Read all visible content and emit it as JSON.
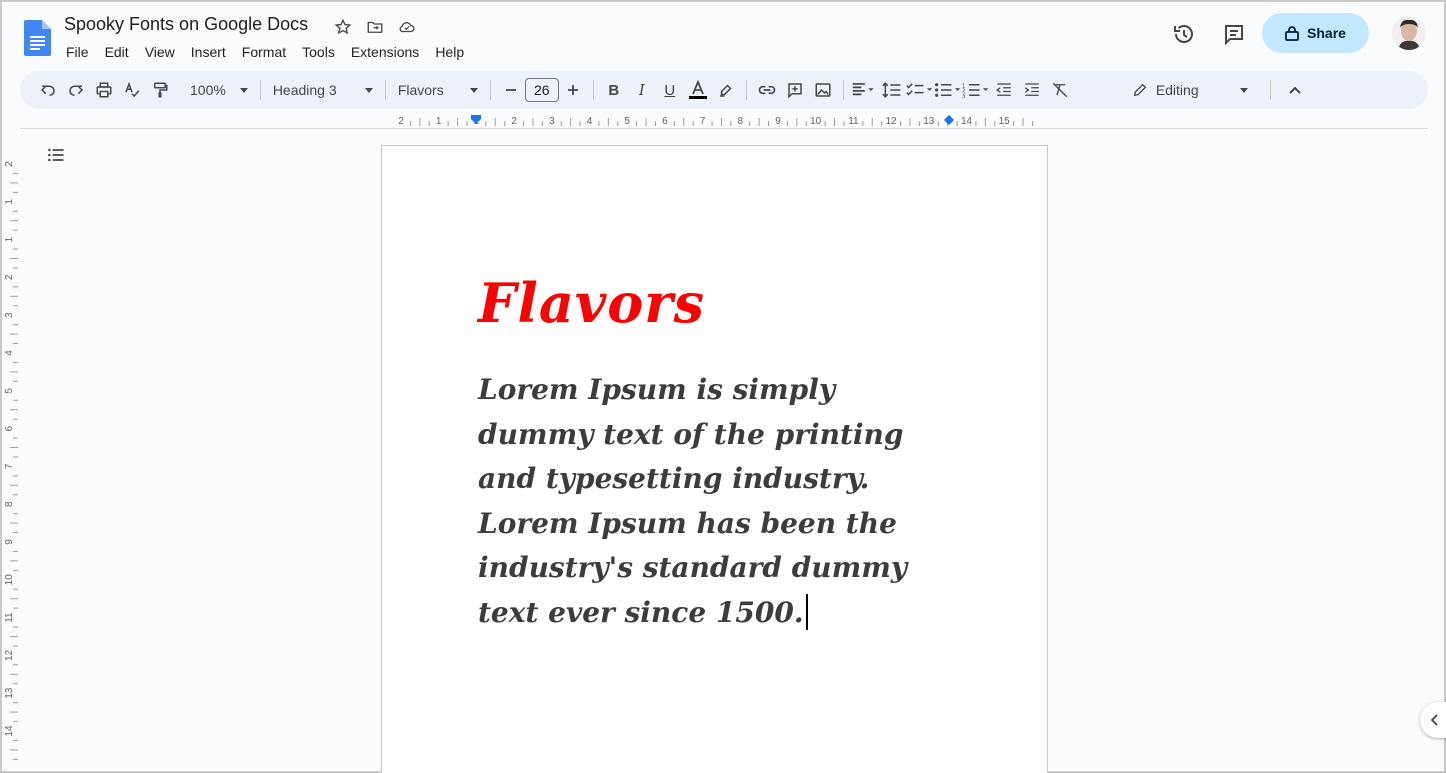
{
  "document": {
    "title": "Spooky Fonts on Google Docs",
    "heading": "Flavors",
    "body": "Lorem Ipsum is simply dummy text of the printing and typesetting industry. Lorem Ipsum has been the industry's standard dummy text ever since 1500."
  },
  "menu": [
    "File",
    "Edit",
    "View",
    "Insert",
    "Format",
    "Tools",
    "Extensions",
    "Help"
  ],
  "header": {
    "share_label": "Share"
  },
  "toolbar": {
    "zoom": "100%",
    "style": "Heading 3",
    "font": "Flavors",
    "font_size": "26",
    "mode": "Editing"
  },
  "ruler": {
    "h_labels": [
      "2",
      "1",
      "1",
      "2",
      "3",
      "4",
      "5",
      "6",
      "7",
      "8",
      "9",
      "10",
      "11",
      "12",
      "13",
      "14",
      "15"
    ],
    "v_labels": [
      "2",
      "1",
      "1",
      "2",
      "3",
      "4",
      "5",
      "6",
      "7",
      "8",
      "9",
      "10",
      "11",
      "12",
      "13",
      "14"
    ]
  },
  "colors": {
    "accent": "#c2e7ff",
    "heading": "#ff0000",
    "toolbar_bg": "#edf2fa",
    "doc_blue": "#4285f4"
  }
}
